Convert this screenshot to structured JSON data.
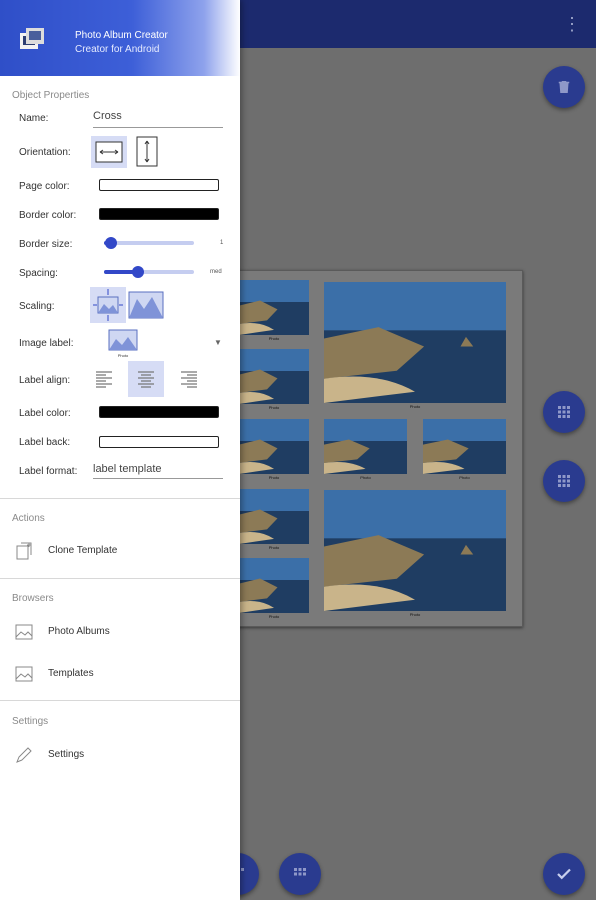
{
  "app": {
    "title": "Photo Album Creator",
    "subtitle": "Creator for Android",
    "overflow_icon": "more-vert-icon"
  },
  "object_properties": {
    "section_title": "Object Properties",
    "name_label": "Name:",
    "name_value": "Cross",
    "orientation_label": "Orientation:",
    "orientation_selected": "horizontal",
    "page_color_label": "Page color:",
    "page_color": "#ffffff",
    "border_color_label": "Border color:",
    "border_color": "#000000",
    "border_size_label": "Border size:",
    "border_size_value": "1",
    "border_size_level": 0.08,
    "spacing_label": "Spacing:",
    "spacing_value": "med",
    "spacing_level": 0.38,
    "scaling_label": "Scaling:",
    "scaling_selected": "fit",
    "image_label_label": "Image label:",
    "image_label_caption": "Photo",
    "label_align_label": "Label align:",
    "label_align_selected": "center",
    "label_color_label": "Label color:",
    "label_color": "#000000",
    "label_back_label": "Label back:",
    "label_back_color": "#ffffff",
    "label_format_label": "Label format:",
    "label_format_value": "label template"
  },
  "actions": {
    "section_title": "Actions",
    "clone_label": "Clone Template"
  },
  "browsers": {
    "section_title": "Browsers",
    "albums_label": "Photo Albums",
    "templates_label": "Templates"
  },
  "settings": {
    "section_title": "Settings",
    "settings_label": "Settings"
  },
  "canvas": {
    "photo_caption": "Photo"
  },
  "colors": {
    "appbar": "#1c2a6e",
    "accent": "#3248c8",
    "fab": "#2a3b8f"
  }
}
